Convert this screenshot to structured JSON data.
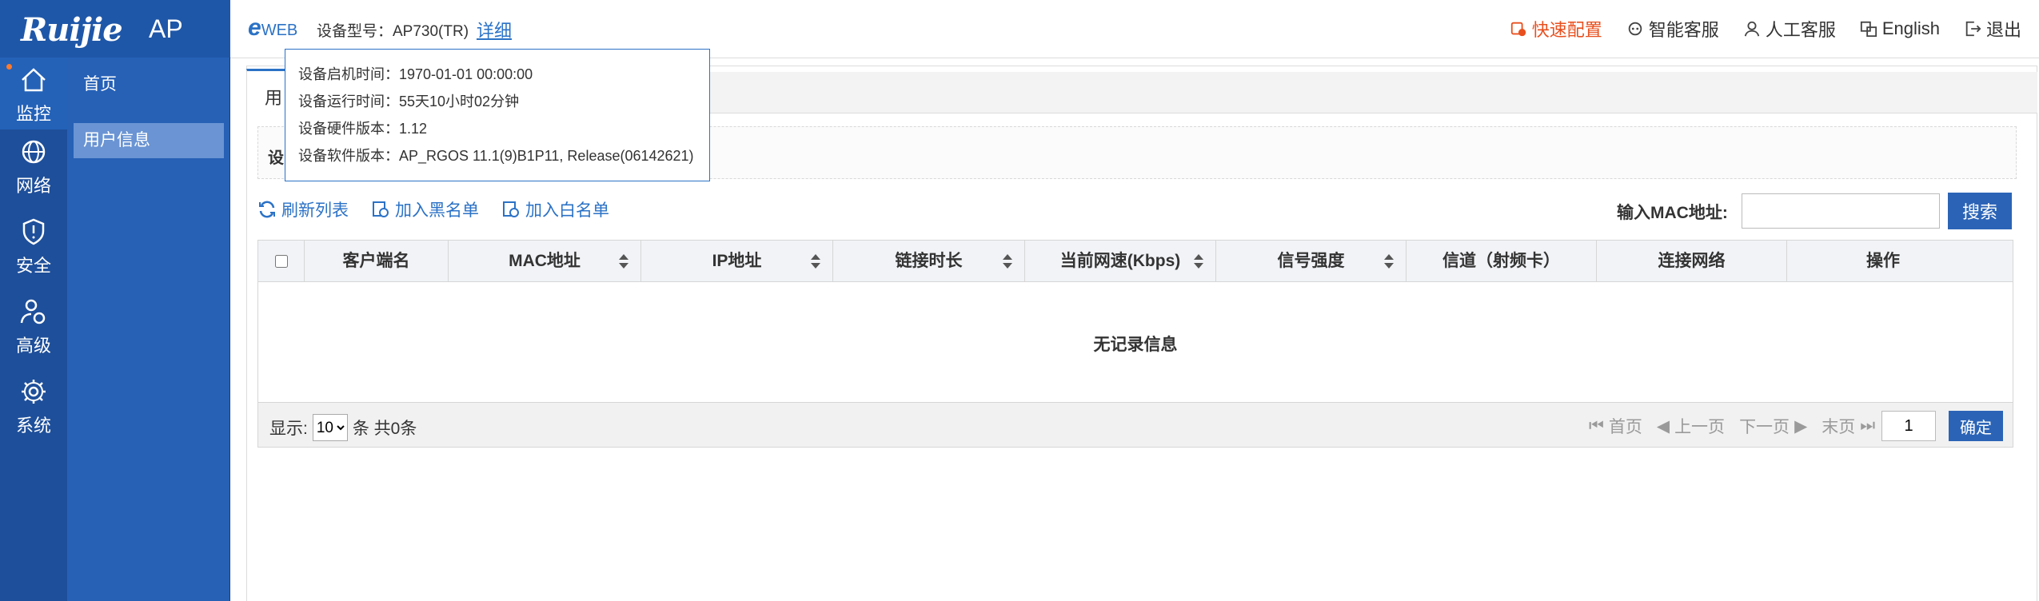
{
  "header": {
    "logo": "Ruijie",
    "product": "AP",
    "eweb_e": "e",
    "eweb_text": "WEB",
    "model_label": "设备型号：AP730(TR)",
    "detail_link": "详细",
    "nav": [
      {
        "label": "快速配置",
        "icon": "quick-config-icon"
      },
      {
        "label": "智能客服",
        "icon": "smart-service-icon"
      },
      {
        "label": "人工客服",
        "icon": "human-service-icon"
      },
      {
        "label": "English",
        "icon": "language-icon"
      },
      {
        "label": "退出",
        "icon": "logout-icon"
      }
    ],
    "accent_color": "#e8501f"
  },
  "rail": {
    "items": [
      {
        "label": "监控",
        "icon": "home-icon"
      },
      {
        "label": "网络",
        "icon": "network-globe-icon"
      },
      {
        "label": "安全",
        "icon": "shield-icon"
      },
      {
        "label": "高级",
        "icon": "user-gear-icon"
      },
      {
        "label": "系统",
        "icon": "gear-icon"
      }
    ]
  },
  "submenu": {
    "items": [
      {
        "label": "首页"
      },
      {
        "label": "用户信息"
      }
    ]
  },
  "main": {
    "tab_label": "用",
    "info_label": "设"
  },
  "tooltip": {
    "rows": [
      "设备启机时间：1970-01-01 00:00:00",
      "设备运行时间：55天10小时02分钟",
      "设备硬件版本：1.12",
      "设备软件版本：AP_RGOS 11.1(9)B1P11, Release(06142621)"
    ]
  },
  "toolbar": {
    "refresh": "刷新列表",
    "blacklist": "加入黑名单",
    "whitelist": "加入白名单"
  },
  "search": {
    "label": "输入MAC地址:",
    "value": "",
    "button": "搜索"
  },
  "table": {
    "columns": [
      "客户端名",
      "MAC地址",
      "IP地址",
      "链接时长",
      "当前网速(Kbps)",
      "信号强度",
      "信道（射频卡）",
      "连接网络",
      "操作"
    ],
    "empty_text": "无记录信息"
  },
  "footer": {
    "show_label": "显示:",
    "page_size": "10",
    "count_text": "条 共0条",
    "first": "首页",
    "prev": "上一页",
    "next": "下一页",
    "last": "末页",
    "page_value": "1",
    "confirm": "确定"
  },
  "colors": {
    "sidebar": "#1e4f9a",
    "primary": "#2b64b7"
  }
}
